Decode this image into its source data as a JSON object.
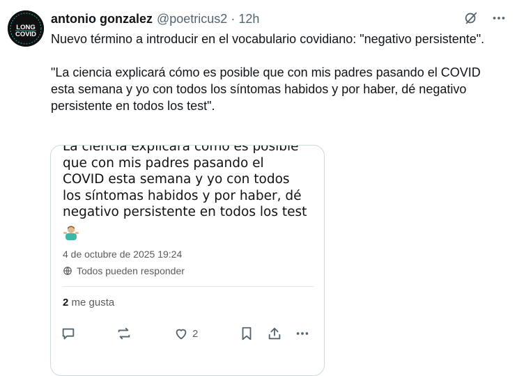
{
  "author": {
    "name": "antonio gonzalez",
    "handle": "@poetricus2",
    "separator": "·",
    "time": "12h",
    "avatar_lines": [
      "LONG",
      "COVID"
    ]
  },
  "tweet": {
    "paragraphs": [
      "Nuevo término a introducir en el vocabulario covidiano: \"negativo persistente\".",
      "\"La ciencia explicará cómo es posible que con mis padres pasando el COVID esta semana y yo con todos los síntomas habidos y por haber, dé negativo persistente en todos los test\"."
    ]
  },
  "quoted": {
    "lines": [
      "La ciencia explicará cómo es posible",
      "que con mis padres pasando el",
      "COVID esta semana y yo con todos",
      "los síntomas habidos y por haber, dé",
      "negativo persistente en todos los test"
    ],
    "emoji": "man-shrugging-emoji",
    "date": "4 de octubre de 2025 19:24",
    "reply_setting": "Todos pueden responder",
    "likes_count": "2",
    "likes_label": "me gusta",
    "actions": {
      "reply_icon": "comment-icon",
      "repost_icon": "repost-icon",
      "like_icon": "heart-icon",
      "like_count": "2",
      "bookmark_icon": "bookmark-icon",
      "share_icon": "share-icon",
      "more_icon": "more-icon"
    }
  },
  "top_icons": [
    "grok-icon",
    "more-options-icon"
  ],
  "colors": {
    "text": "#0f1419",
    "secondary": "#536471",
    "border": "#cfd9de",
    "avatar_bg": "#101010",
    "avatar_accent": "#2aa3a6"
  }
}
